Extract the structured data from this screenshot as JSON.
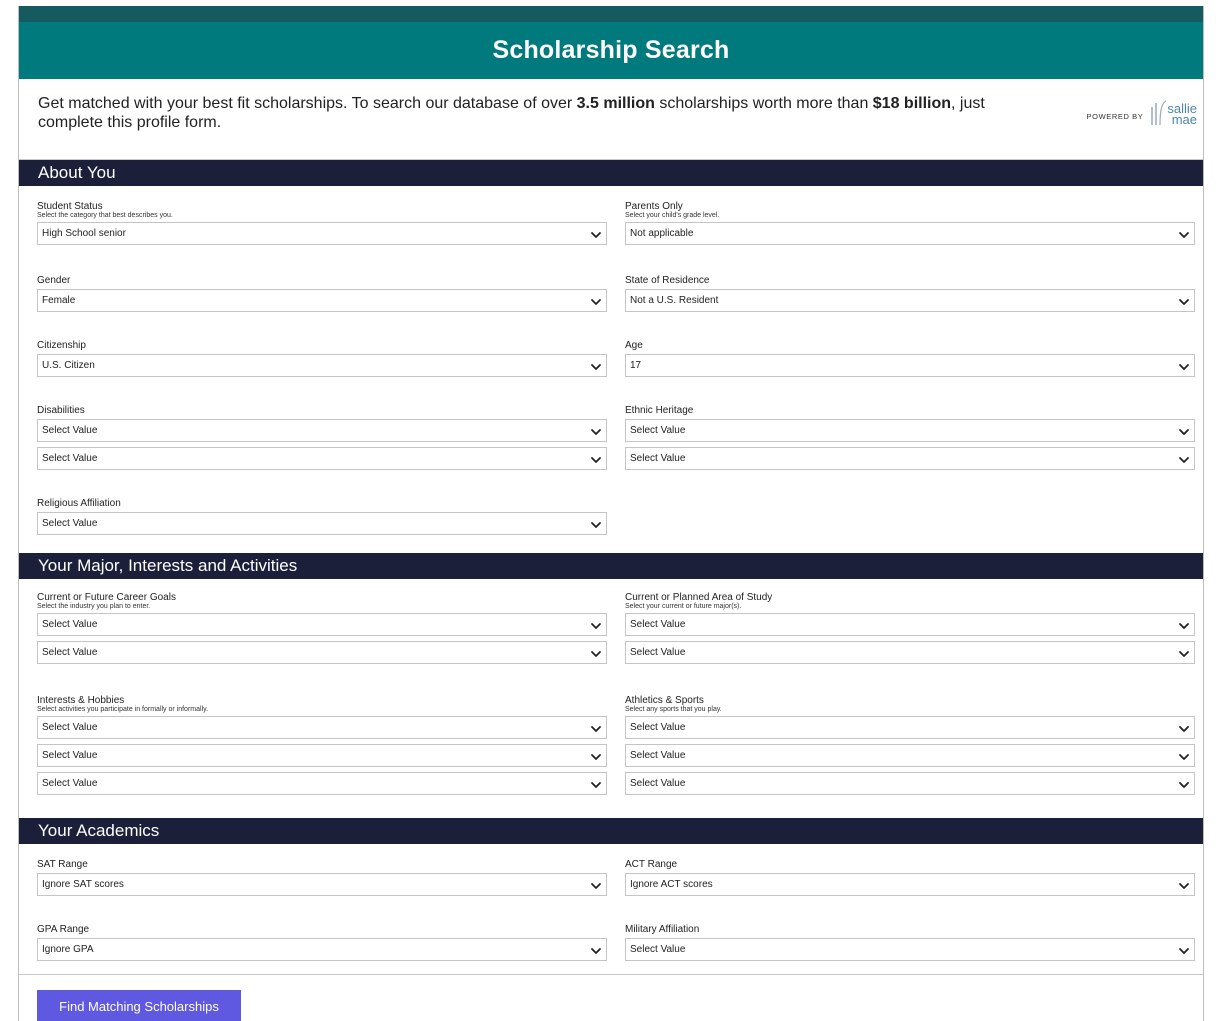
{
  "header": {
    "title": "Scholarship Search"
  },
  "intro": {
    "part1": "Get matched with your best fit scholarships. To search our database of over ",
    "bold1": "3.5 million",
    "part2": " scholarships worth more than ",
    "bold2": "$18 billion",
    "part3": ", just complete this profile form.",
    "powered_by": "Powered By",
    "logo_line1": "sallie",
    "logo_line2": "mae"
  },
  "sections": {
    "about": "About You",
    "major": "Your Major, Interests and Activities",
    "academics": "Your Academics"
  },
  "fields": {
    "student_status": {
      "label": "Student Status",
      "hint": "Select the category that best describes you.",
      "values": [
        "High School senior"
      ]
    },
    "parents_only": {
      "label": "Parents Only",
      "hint": "Select your child's grade level.",
      "values": [
        "Not applicable"
      ]
    },
    "gender": {
      "label": "Gender",
      "values": [
        "Female"
      ]
    },
    "state": {
      "label": "State of Residence",
      "values": [
        "Not a U.S. Resident"
      ]
    },
    "citizenship": {
      "label": "Citizenship",
      "values": [
        "U.S. Citizen"
      ]
    },
    "age": {
      "label": "Age",
      "values": [
        "17"
      ]
    },
    "disabilities": {
      "label": "Disabilities",
      "values": [
        "Select Value",
        "Select Value"
      ]
    },
    "ethnic": {
      "label": "Ethnic Heritage",
      "values": [
        "Select Value",
        "Select Value"
      ]
    },
    "religious": {
      "label": "Religious Affiliation",
      "values": [
        "Select Value"
      ]
    },
    "career": {
      "label": "Current or Future Career Goals",
      "hint": "Select the industry you plan to enter.",
      "values": [
        "Select Value",
        "Select Value"
      ]
    },
    "study": {
      "label": "Current or Planned Area of Study",
      "hint": "Select your current or future major(s).",
      "values": [
        "Select Value",
        "Select Value"
      ]
    },
    "interests": {
      "label": "Interests & Hobbies",
      "hint": "Select activities you participate in formally or informally.",
      "values": [
        "Select Value",
        "Select Value",
        "Select Value"
      ]
    },
    "athletics": {
      "label": "Athletics & Sports",
      "hint": "Select any sports that you play.",
      "values": [
        "Select Value",
        "Select Value",
        "Select Value"
      ]
    },
    "sat": {
      "label": "SAT Range",
      "values": [
        "Ignore SAT scores"
      ]
    },
    "act": {
      "label": "ACT Range",
      "values": [
        "Ignore ACT scores"
      ]
    },
    "gpa": {
      "label": "GPA Range",
      "values": [
        "Ignore GPA"
      ]
    },
    "military": {
      "label": "Military Affiliation",
      "values": [
        "Select Value"
      ]
    }
  },
  "footer": {
    "button_label": "Find Matching Scholarships"
  },
  "colors": {
    "header": "#007a7c",
    "topstrip": "#145a5e",
    "section": "#1c1f3a",
    "button": "#5f58e0"
  },
  "icons": {
    "dropdown": "chevron-down-icon"
  }
}
